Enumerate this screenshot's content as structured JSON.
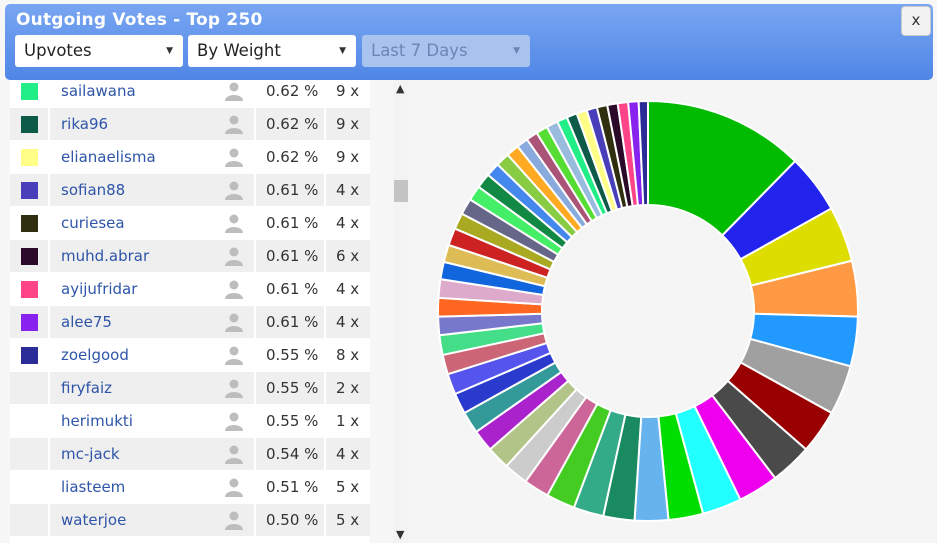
{
  "window": {
    "title": "Outgoing Votes - Top 250",
    "close_label": "x"
  },
  "filters": {
    "vote_type": {
      "selected": "Upvotes"
    },
    "sort": {
      "selected": "By Weight"
    },
    "period": {
      "selected": "Last 7 Days",
      "disabled": true
    }
  },
  "list": {
    "rows": [
      {
        "color": "#22ee88",
        "name": "sailawana",
        "percent": "0.62 %",
        "count": "9 x"
      },
      {
        "color": "#0e5a48",
        "name": "rika96",
        "percent": "0.62 %",
        "count": "9 x"
      },
      {
        "color": "#ffff88",
        "name": "elianaelisma",
        "percent": "0.62 %",
        "count": "9 x"
      },
      {
        "color": "#4a3fbb",
        "name": "sofian88",
        "percent": "0.61 %",
        "count": "4 x"
      },
      {
        "color": "#303010",
        "name": "curiesea",
        "percent": "0.61 %",
        "count": "4 x"
      },
      {
        "color": "#2a0a28",
        "name": "muhd.abrar",
        "percent": "0.61 %",
        "count": "6 x"
      },
      {
        "color": "#ff4488",
        "name": "ayijufridar",
        "percent": "0.61 %",
        "count": "4 x"
      },
      {
        "color": "#8822ee",
        "name": "alee75",
        "percent": "0.61 %",
        "count": "4 x"
      },
      {
        "color": "#2c2c99",
        "name": "zoelgood",
        "percent": "0.55 %",
        "count": "8 x"
      },
      {
        "color": "",
        "name": "firyfaiz",
        "percent": "0.55 %",
        "count": "2 x"
      },
      {
        "color": "",
        "name": "herimukti",
        "percent": "0.55 %",
        "count": "1 x"
      },
      {
        "color": "",
        "name": "mc-jack",
        "percent": "0.54 %",
        "count": "4 x"
      },
      {
        "color": "",
        "name": "liasteem",
        "percent": "0.51 %",
        "count": "5 x"
      },
      {
        "color": "",
        "name": "waterjoe",
        "percent": "0.50 %",
        "count": "5 x"
      }
    ]
  },
  "chart_data": {
    "type": "pie",
    "style": "donut",
    "legend": "none",
    "slices": [
      {
        "color": "#00bb00",
        "value": 13.9
      },
      {
        "color": "#2323ee",
        "value": 5.1
      },
      {
        "color": "#dddd00",
        "value": 4.8
      },
      {
        "color": "#ff9944",
        "value": 4.8
      },
      {
        "color": "#2299ff",
        "value": 4.3
      },
      {
        "color": "#a0a0a0",
        "value": 4.3
      },
      {
        "color": "#990000",
        "value": 3.8
      },
      {
        "color": "#4a4a4a",
        "value": 3.6
      },
      {
        "color": "#ee00ee",
        "value": 3.5
      },
      {
        "color": "#22ffff",
        "value": 3.4
      },
      {
        "color": "#00dd00",
        "value": 3.0
      },
      {
        "color": "#66b3ee",
        "value": 2.9
      },
      {
        "color": "#1a8a60",
        "value": 2.7
      },
      {
        "color": "#33aa88",
        "value": 2.6
      },
      {
        "color": "#44cc22",
        "value": 2.5
      },
      {
        "color": "#cc6699",
        "value": 2.2
      },
      {
        "color": "#cccccc",
        "value": 2.1
      },
      {
        "color": "#b3c488",
        "value": 2.0
      },
      {
        "color": "#aa22cc",
        "value": 1.9
      },
      {
        "color": "#339999",
        "value": 1.9
      },
      {
        "color": "#2a3acc",
        "value": 1.8
      },
      {
        "color": "#5555ee",
        "value": 1.8
      },
      {
        "color": "#cc6677",
        "value": 1.7
      },
      {
        "color": "#44dd88",
        "value": 1.7
      },
      {
        "color": "#7777cc",
        "value": 1.6
      },
      {
        "color": "#ff6622",
        "value": 1.6
      },
      {
        "color": "#ddaacc",
        "value": 1.6
      },
      {
        "color": "#1166dd",
        "value": 1.5
      },
      {
        "color": "#ddbb55",
        "value": 1.5
      },
      {
        "color": "#cc2222",
        "value": 1.5
      },
      {
        "color": "#aaaa22",
        "value": 1.4
      },
      {
        "color": "#666688",
        "value": 1.4
      },
      {
        "color": "#44ee66",
        "value": 1.3
      },
      {
        "color": "#118844",
        "value": 1.3
      },
      {
        "color": "#4488ee",
        "value": 1.2
      },
      {
        "color": "#88cc44",
        "value": 1.2
      },
      {
        "color": "#ffaa22",
        "value": 1.1
      },
      {
        "color": "#88aadd",
        "value": 1.0
      },
      {
        "color": "#aa5577",
        "value": 1.0
      },
      {
        "color": "#55dd33",
        "value": 1.0
      },
      {
        "color": "#99bbdd",
        "value": 1.0
      },
      {
        "color": "#22ee88",
        "value": 0.9
      },
      {
        "color": "#0e5a48",
        "value": 0.9
      },
      {
        "color": "#ffff88",
        "value": 0.9
      },
      {
        "color": "#4a3fbb",
        "value": 0.9
      },
      {
        "color": "#303010",
        "value": 0.9
      },
      {
        "color": "#2a0a28",
        "value": 0.9
      },
      {
        "color": "#ff4488",
        "value": 0.9
      },
      {
        "color": "#8822ee",
        "value": 0.9
      },
      {
        "color": "#2c2c99",
        "value": 0.8
      }
    ]
  }
}
